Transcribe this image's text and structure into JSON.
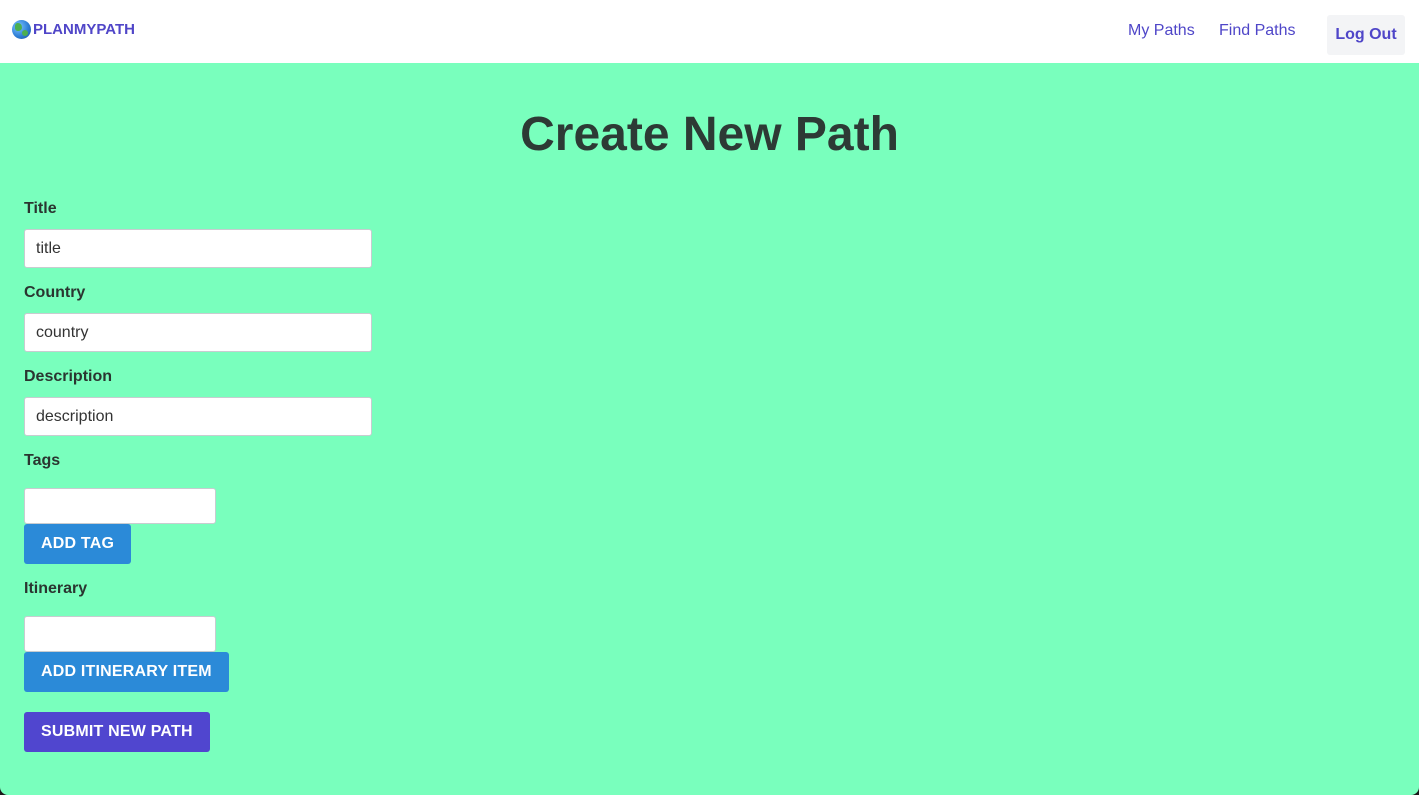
{
  "nav": {
    "brand": "PLANMYPATH",
    "brand_icon": "globe-icon",
    "links": [
      "My Paths",
      "Find Paths"
    ],
    "logout_label": "Log Out"
  },
  "page": {
    "title": "Create New Path"
  },
  "form": {
    "title_label": "Title",
    "title_placeholder": "title",
    "country_label": "Country",
    "country_placeholder": "country",
    "description_label": "Description",
    "description_placeholder": "description",
    "tags_label": "Tags",
    "add_tag_label": "ADD TAG",
    "itinerary_label": "Itinerary",
    "add_itinerary_label": "ADD ITINERARY ITEM",
    "submit_label": "SUBMIT NEW PATH"
  },
  "colors": {
    "background": "#79ffbd",
    "brand": "#5046c8",
    "button_blue": "#2b8ad8",
    "button_purple": "#5046cf"
  }
}
